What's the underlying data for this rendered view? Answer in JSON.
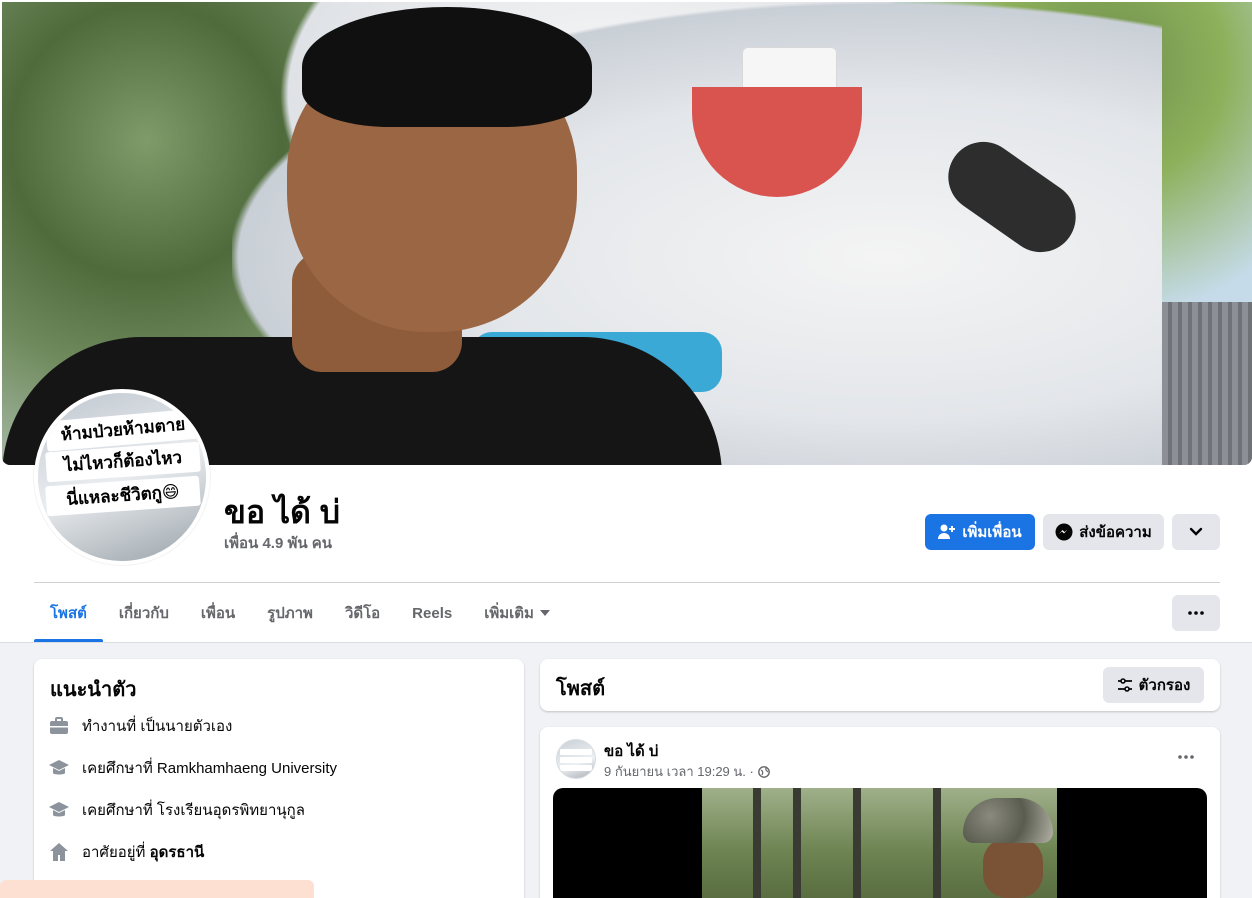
{
  "profile": {
    "name": "ขอ ได้ บ่",
    "friends_count": "เพื่อน 4.9 พัน คน",
    "avatar_text": [
      "ห้ามป่วยห้ามตาย",
      "ไม่ไหวก็ต้องไหว",
      "นี่แหละชีวิตกู😄"
    ]
  },
  "actions": {
    "add_friend_label": "เพิ่มเพื่อน",
    "message_label": "ส่งข้อความ"
  },
  "tabs": [
    {
      "label": "โพสต์",
      "active": true
    },
    {
      "label": "เกี่ยวกับ"
    },
    {
      "label": "เพื่อน"
    },
    {
      "label": "รูปภาพ"
    },
    {
      "label": "วิดีโอ"
    },
    {
      "label": "Reels"
    },
    {
      "label": "เพิ่มเติม"
    }
  ],
  "intro": {
    "title": "แนะนำตัว",
    "items": [
      {
        "icon": "briefcase-icon",
        "text": "ทำงานที่ เป็นนายตัวเอง"
      },
      {
        "icon": "graduation-cap-icon",
        "text": "เคยศึกษาที่ Ramkhamhaeng University"
      },
      {
        "icon": "graduation-cap-icon",
        "text": "เคยศึกษาที่ โรงเรียนอุดรพิทยานุกูล"
      },
      {
        "icon": "home-icon",
        "prefix": "อาศัยอยู่ที่ ",
        "bold": "อุดรธานี"
      }
    ]
  },
  "posts": {
    "title": "โพสต์",
    "filter_label": "ตัวกรอง"
  },
  "post": {
    "author": "ขอ ได้ บ่",
    "meta": "9 กันยายน เวลา 19:29 น. ·"
  },
  "colors": {
    "accent": "#1b74e4",
    "background": "#f0f2f5",
    "secondary_button": "#e4e6eb",
    "muted_text": "#65676b"
  }
}
